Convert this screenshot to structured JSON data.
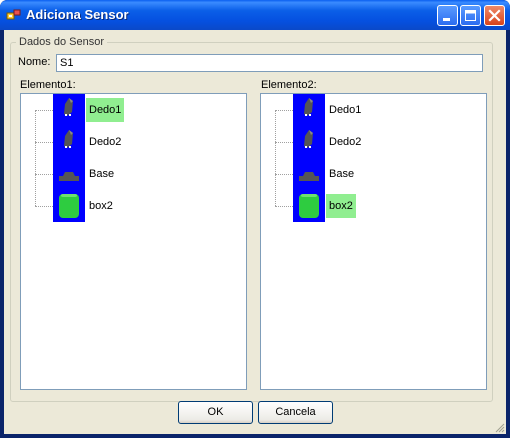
{
  "window": {
    "title": "Adiciona Sensor"
  },
  "group": {
    "legend": "Dados do Sensor",
    "nome_label": "Nome:",
    "nome_value": "S1",
    "elemento1_label": "Elemento1:",
    "elemento2_label": "Elemento2:"
  },
  "tree1": {
    "items": [
      {
        "label": "Dedo1",
        "icon": "finger-icon",
        "selected": true
      },
      {
        "label": "Dedo2",
        "icon": "finger-icon",
        "selected": false
      },
      {
        "label": "Base",
        "icon": "base-icon",
        "selected": false
      },
      {
        "label": "box2",
        "icon": "cylinder-icon",
        "selected": false
      }
    ]
  },
  "tree2": {
    "items": [
      {
        "label": "Dedo1",
        "icon": "finger-icon",
        "selected": false
      },
      {
        "label": "Dedo2",
        "icon": "finger-icon",
        "selected": false
      },
      {
        "label": "Base",
        "icon": "base-icon",
        "selected": false
      },
      {
        "label": "box2",
        "icon": "cylinder-icon",
        "selected": true
      }
    ]
  },
  "buttons": {
    "ok_label": "OK",
    "cancel_label": "Cancela"
  },
  "colors": {
    "icon_background": "#0000ff",
    "selection": "#90ee90",
    "titlebar": "#0b5fe8"
  }
}
